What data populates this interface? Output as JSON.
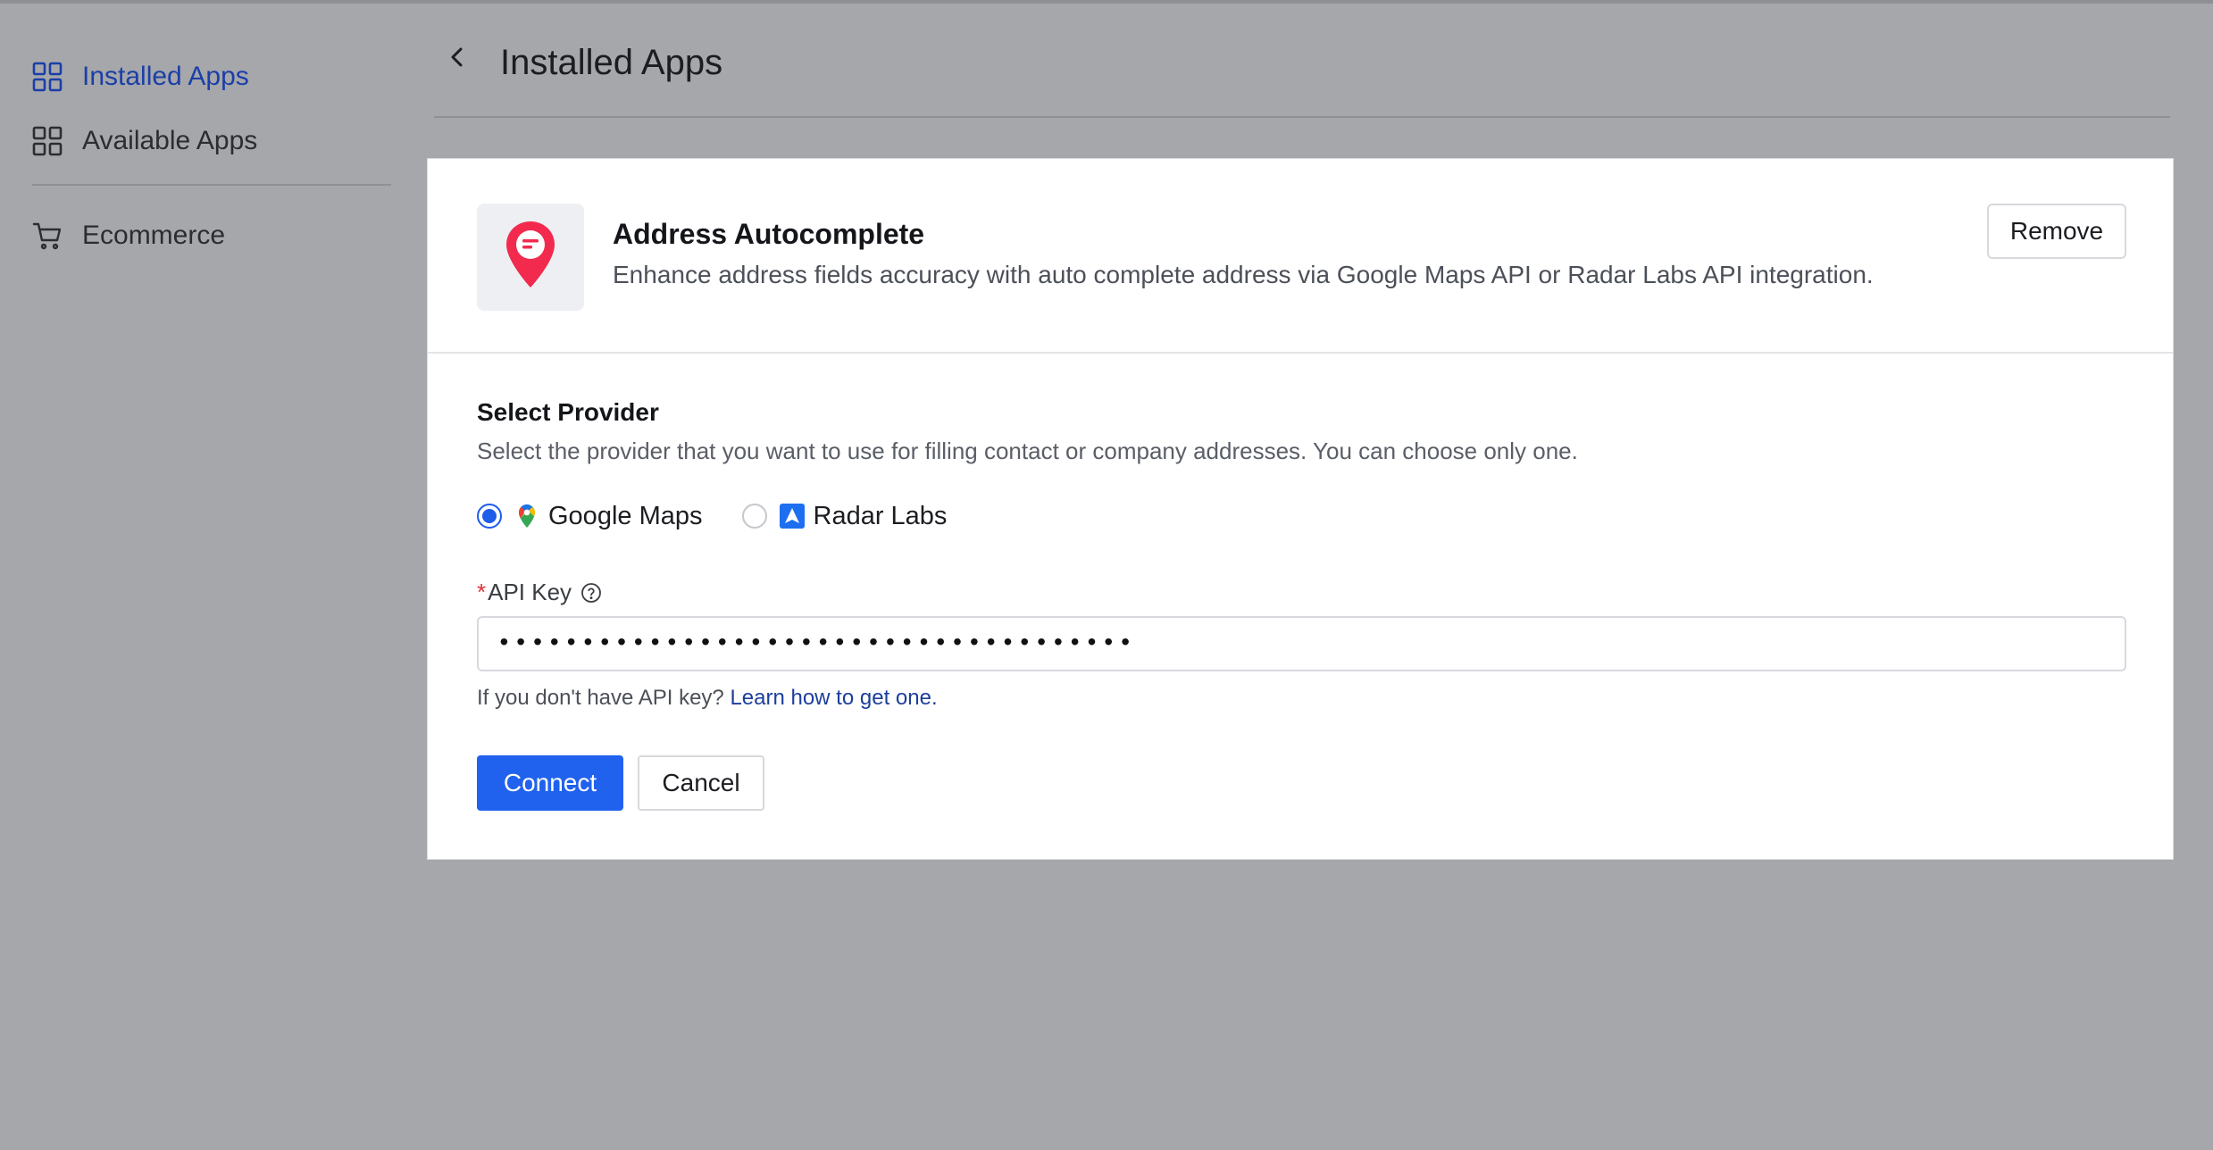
{
  "sidebar": {
    "items": [
      {
        "label": "Installed Apps",
        "icon": "grid-icon",
        "active": true
      },
      {
        "label": "Available Apps",
        "icon": "grid-icon",
        "active": false
      },
      {
        "label": "Ecommerce",
        "icon": "cart-icon",
        "active": false
      }
    ]
  },
  "header": {
    "title": "Installed Apps",
    "back_icon": "chevron-left-icon"
  },
  "app": {
    "name": "Address Autocomplete",
    "description": "Enhance address fields accuracy with auto complete address via Google Maps API or Radar Labs API integration.",
    "logo_icon": "map-pin-icon",
    "remove_label": "Remove"
  },
  "provider": {
    "title": "Select Provider",
    "description": "Select the provider that you want to use for filling contact or company addresses. You can choose only one.",
    "options": [
      {
        "label": "Google Maps",
        "checked": true,
        "icon": "google-maps-icon"
      },
      {
        "label": "Radar Labs",
        "checked": false,
        "icon": "radar-labs-icon"
      }
    ]
  },
  "api_key": {
    "required_mark": "*",
    "label": "API Key",
    "value": "••••••••••••••••••••••••••••••••••••••",
    "hint_text": "If you don't have API key? ",
    "hint_link": "Learn how to get one."
  },
  "actions": {
    "connect_label": "Connect",
    "cancel_label": "Cancel"
  },
  "colors": {
    "accent": "#2062ee",
    "active_nav": "#1b3fa8",
    "overlay": "#a6a7aa",
    "required": "#e0303a"
  }
}
